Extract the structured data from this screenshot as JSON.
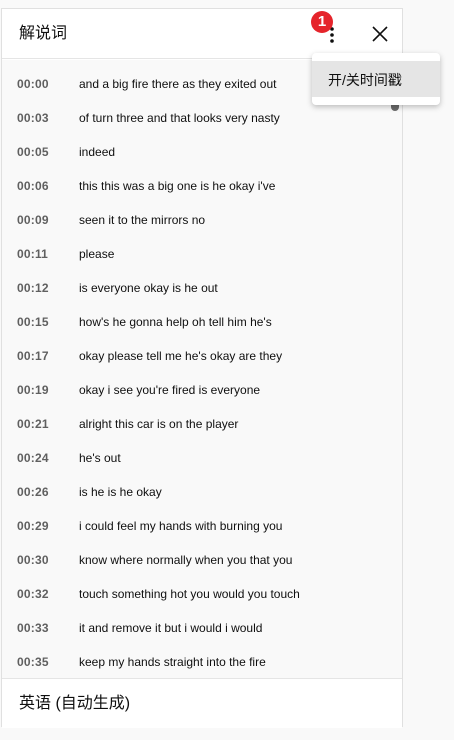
{
  "header": {
    "title": "解说词",
    "notification_badge": "1",
    "more_icon": "more-vert-icon",
    "close_icon": "close-icon"
  },
  "menu": {
    "items": [
      {
        "label": "开/关时间戳"
      }
    ]
  },
  "segments": [
    {
      "time": "00:00",
      "text": "and a big fire there as they exited out"
    },
    {
      "time": "00:03",
      "text": "of turn three and that looks very nasty"
    },
    {
      "time": "00:05",
      "text": "indeed"
    },
    {
      "time": "00:06",
      "text": "this this was a big one is he okay i've"
    },
    {
      "time": "00:09",
      "text": "seen it to the mirrors no"
    },
    {
      "time": "00:11",
      "text": "please"
    },
    {
      "time": "00:12",
      "text": "is everyone okay is he out"
    },
    {
      "time": "00:15",
      "text": "how's he gonna help oh tell him he's"
    },
    {
      "time": "00:17",
      "text": "okay please tell me he's okay are they"
    },
    {
      "time": "00:19",
      "text": "okay i see you're fired is everyone"
    },
    {
      "time": "00:21",
      "text": "alright this car is on the player"
    },
    {
      "time": "00:24",
      "text": "he's out"
    },
    {
      "time": "00:26",
      "text": "is he is he okay"
    },
    {
      "time": "00:29",
      "text": "i could feel my hands with burning you"
    },
    {
      "time": "00:30",
      "text": "know where normally when you that you"
    },
    {
      "time": "00:32",
      "text": "touch something hot you would you touch"
    },
    {
      "time": "00:33",
      "text": "it and remove it but i would i would"
    },
    {
      "time": "00:35",
      "text": "keep my hands straight into the fire"
    }
  ],
  "footer": {
    "language_label": "英语 (自动生成)"
  },
  "colors": {
    "badge": "#e5242b",
    "menu_highlight": "#e5e5e5",
    "list_background": "#f9f9f9"
  }
}
